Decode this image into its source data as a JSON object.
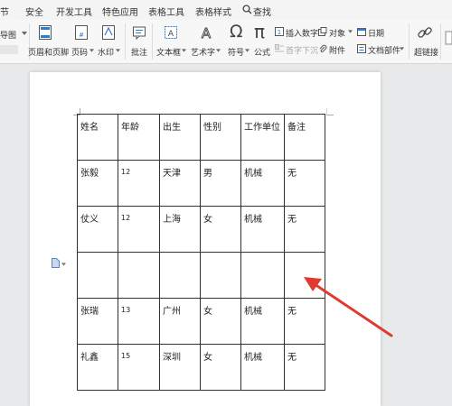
{
  "menu": [
    "节",
    "安全",
    "开发工具",
    "特色应用",
    "表格工具",
    "表格样式",
    "查找"
  ],
  "ribbon": {
    "left_partial": "导图",
    "header_footer": "页眉和页脚",
    "page_number": "页码",
    "watermark": "水印",
    "comment": "批注",
    "textbox": "文本框",
    "wordart": "艺术字",
    "symbol": "符号",
    "formula": "公式",
    "insert_number": "插入数字",
    "object": "对象",
    "date": "日期",
    "dropcap": "首字下沉",
    "attachment": "附件",
    "doc_parts": "文档部件",
    "hyperlink": "超链接"
  },
  "table": {
    "headers": [
      "姓名",
      "年龄",
      "出生",
      "性别",
      "工作单位",
      "备注"
    ],
    "rows": [
      [
        "张毅",
        "12",
        "天津",
        "男",
        "机械",
        "无"
      ],
      [
        "仗义",
        "12",
        "上海",
        "女",
        "机械",
        "无"
      ],
      [
        "",
        "",
        "",
        "",
        "",
        ""
      ],
      [
        "张瑞",
        "13",
        "广州",
        "女",
        "机械",
        "无"
      ],
      [
        "礼鑫",
        "15",
        "深圳",
        "女",
        "机械",
        "无"
      ]
    ]
  },
  "colors": {
    "arrow": "#e03a30",
    "accent": "#2b7cd3"
  }
}
